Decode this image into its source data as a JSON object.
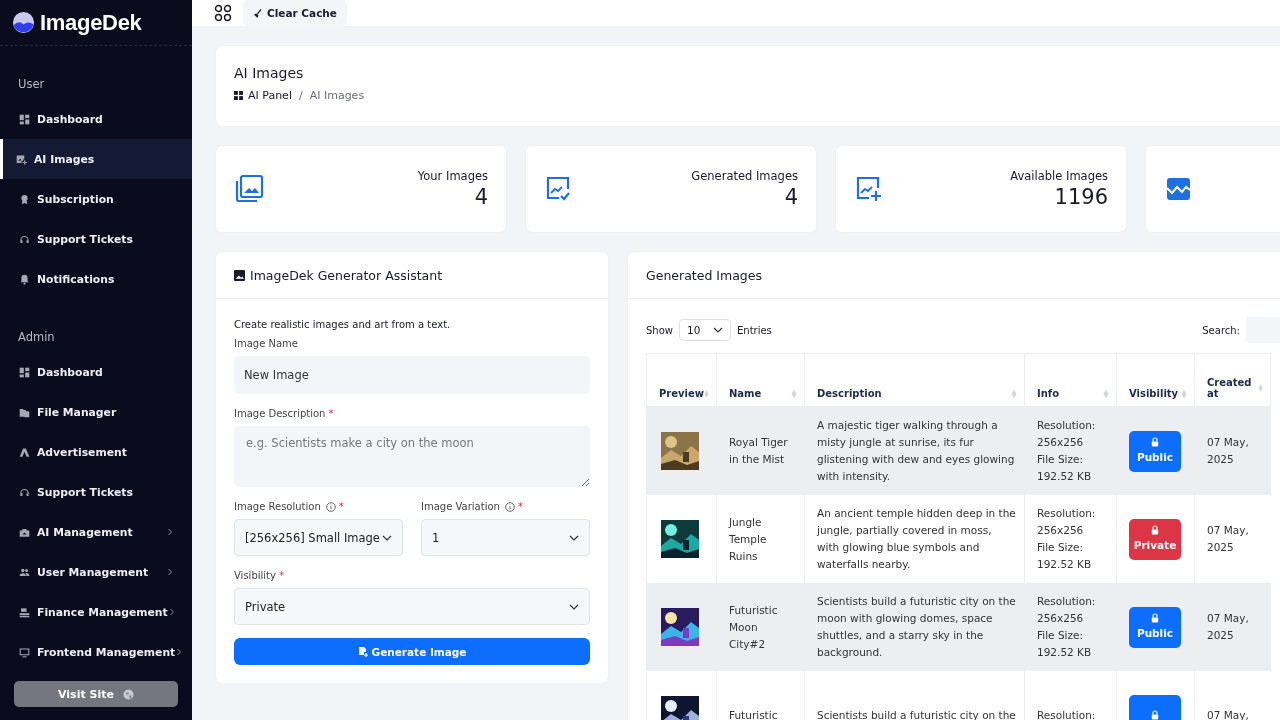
{
  "brand": {
    "name": "ImageDek"
  },
  "topbar": {
    "clear_cache": "Clear Cache"
  },
  "sidebar": {
    "sections": [
      {
        "title": "User",
        "items": [
          {
            "label": "Dashboard",
            "kind": "dashboard",
            "selected": false,
            "has_children": false
          },
          {
            "label": "AI Images",
            "kind": "image-add",
            "selected": true,
            "has_children": false
          },
          {
            "label": "Subscription",
            "kind": "award",
            "selected": false,
            "has_children": false
          },
          {
            "label": "Support Tickets",
            "kind": "headset",
            "selected": false,
            "has_children": false
          },
          {
            "label": "Notifications",
            "kind": "bell",
            "selected": false,
            "has_children": false
          }
        ]
      },
      {
        "title": "Admin",
        "items": [
          {
            "label": "Dashboard",
            "kind": "dashboard",
            "selected": false,
            "has_children": false
          },
          {
            "label": "File Manager",
            "kind": "files",
            "selected": false,
            "has_children": false
          },
          {
            "label": "Advertisement",
            "kind": "ads",
            "selected": false,
            "has_children": false
          },
          {
            "label": "Support Tickets",
            "kind": "headset",
            "selected": false,
            "has_children": false
          },
          {
            "label": "AI Management",
            "kind": "briefcase",
            "selected": false,
            "has_children": true
          },
          {
            "label": "User Management",
            "kind": "users",
            "selected": false,
            "has_children": true
          },
          {
            "label": "Finance Management",
            "kind": "register",
            "selected": false,
            "has_children": true
          },
          {
            "label": "Frontend Management",
            "kind": "monitor",
            "selected": false,
            "has_children": true
          }
        ]
      }
    ],
    "visit_site": "Visit Site"
  },
  "page_header": {
    "title": "AI Images",
    "breadcrumb": [
      "AI Panel",
      "AI Images"
    ],
    "breadcrumb_separator": "/"
  },
  "stats": [
    {
      "kind": "gallery",
      "label": "Your Images",
      "value": "4"
    },
    {
      "kind": "image-check",
      "label": "Generated Images",
      "value": "4"
    },
    {
      "kind": "image-plus",
      "label": "Available Images",
      "value": "1196"
    },
    {
      "kind": "chart"
    }
  ],
  "generator": {
    "title": "ImageDek Generator Assistant",
    "intro": "Create realistic images and art from a text.",
    "name_label": "Image Name",
    "name_value": "New Image",
    "description_label": "Image Description",
    "description_required": "*",
    "description_placeholder": "e.g. Scientists make a city on the moon",
    "resolution_label": "Image Resolution",
    "resolution_required": "*",
    "resolution_value": "[256x256] Small Image",
    "variation_label": "Image Variation",
    "variation_required": "*",
    "variation_value": "1",
    "visibility_label": "Visibility",
    "visibility_required": "*",
    "visibility_value": "Private",
    "button": "Generate Image"
  },
  "table_panel": {
    "title": "Generated Images",
    "show_label": "Show",
    "page_size": "10",
    "entries_label": "Entries",
    "search_label": "Search:",
    "columns": [
      "Preview",
      "Name",
      "Description",
      "Info",
      "Visibility",
      "Created at"
    ],
    "rows": [
      {
        "name": "Royal Tiger in the Mist",
        "description": "A majestic tiger walking through a misty jungle at sunrise, its fur glistening with dew and eyes glowing with intensity.",
        "info": [
          "Resolution:",
          "256x256",
          "File Size:",
          "192.52 KB"
        ],
        "private": false,
        "badge": "Public",
        "created": "07 May, 2025"
      },
      {
        "name": "Jungle Temple Ruins",
        "description": "An ancient temple hidden deep in the jungle, partially covered in moss, with glowing blue symbols and waterfalls nearby.",
        "info": [
          "Resolution:",
          "256x256",
          "File Size:",
          "192.52 KB"
        ],
        "private": true,
        "badge": "Private",
        "created": "07 May, 2025"
      },
      {
        "name": "Futuristic Moon City#2",
        "description": "Scientists build a futuristic city on the moon with glowing domes, space shuttles, and a starry sky in the background.",
        "info": [
          "Resolution:",
          "256x256",
          "File Size:",
          "192.52 KB"
        ],
        "private": false,
        "badge": "Public",
        "created": "07 May, 2025"
      },
      {
        "name": "Futuristic",
        "description": "Scientists build a futuristic city on the",
        "info": [
          "Resolution:"
        ],
        "private": false,
        "created": "07 May,"
      }
    ]
  }
}
